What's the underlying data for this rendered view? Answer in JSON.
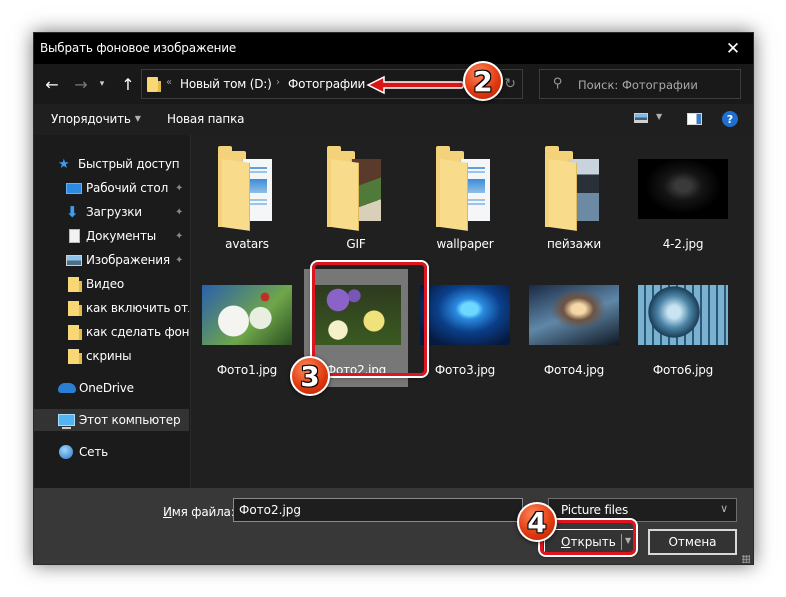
{
  "window": {
    "title": "Выбрать фоновое изображение",
    "close_icon": "close-icon"
  },
  "navigation": {
    "back_icon": "arrow-left-icon",
    "forward_icon": "arrow-right-icon",
    "recent_icon": "chevron-down-icon",
    "up_icon": "arrow-up-icon",
    "breadcrumb": {
      "overflow": "«",
      "separator": "›",
      "items": [
        "Новый том (D:)",
        "Фотографии"
      ]
    },
    "refresh_icon": "refresh-icon",
    "search_placeholder": "Поиск: Фотографии"
  },
  "toolbar": {
    "organize_label": "Упорядочить",
    "new_folder_label": "Новая папка",
    "view_icon": "change-view-icon",
    "preview_pane_icon": "preview-pane-icon",
    "help_icon": "help-icon",
    "help_glyph": "?"
  },
  "sidebar": {
    "items": [
      {
        "label": "Быстрый доступ",
        "icon": "star-icon",
        "pinned": false
      },
      {
        "label": "Рабочий стол",
        "icon": "desktop-icon",
        "pinned": true
      },
      {
        "label": "Загрузки",
        "icon": "download-icon",
        "pinned": true
      },
      {
        "label": "Документы",
        "icon": "documents-icon",
        "pinned": true
      },
      {
        "label": "Изображения",
        "icon": "pictures-icon",
        "pinned": true
      },
      {
        "label": "Видео",
        "icon": "folder-icon",
        "pinned": false
      },
      {
        "label": "как включить отла",
        "icon": "folder-icon",
        "pinned": false
      },
      {
        "label": "как сделать фон в :",
        "icon": "folder-icon",
        "pinned": false
      },
      {
        "label": "скрины",
        "icon": "folder-icon",
        "pinned": false
      },
      {
        "label": "OneDrive",
        "icon": "onedrive-icon",
        "pinned": false
      },
      {
        "label": "Этот компьютер",
        "icon": "computer-icon",
        "pinned": false,
        "selected": true
      },
      {
        "label": "Сеть",
        "icon": "network-icon",
        "pinned": false
      }
    ],
    "pin_glyph": "📌"
  },
  "files": [
    {
      "name": "avatars",
      "type": "folder"
    },
    {
      "name": "GIF",
      "type": "folder"
    },
    {
      "name": "wallpaper",
      "type": "folder"
    },
    {
      "name": "пейзажи",
      "type": "folder"
    },
    {
      "name": "4-2.jpg",
      "type": "image"
    },
    {
      "name": "Фото1.jpg",
      "type": "image"
    },
    {
      "name": "Фото2.jpg",
      "type": "image",
      "selected": true
    },
    {
      "name": "Фото3.jpg",
      "type": "image"
    },
    {
      "name": "Фото4.jpg",
      "type": "image"
    },
    {
      "name": "Фото6.jpg",
      "type": "image"
    }
  ],
  "footer": {
    "filename_label_underlined": "И",
    "filename_label_rest": "мя файла:",
    "filename_value": "Фото2.jpg",
    "filter_value": "Picture files",
    "open_label_underlined": "О",
    "open_label_rest": "ткрыть",
    "cancel_label": "Отмена"
  },
  "annotations": {
    "step2": "2",
    "step3": "3",
    "step4": "4",
    "highlight_color": "#e0141e"
  },
  "colors": {
    "titlebar": "#000000",
    "background": "#191919",
    "content": "#202020",
    "footer": "#383838",
    "accent": "#3d9bf0"
  }
}
